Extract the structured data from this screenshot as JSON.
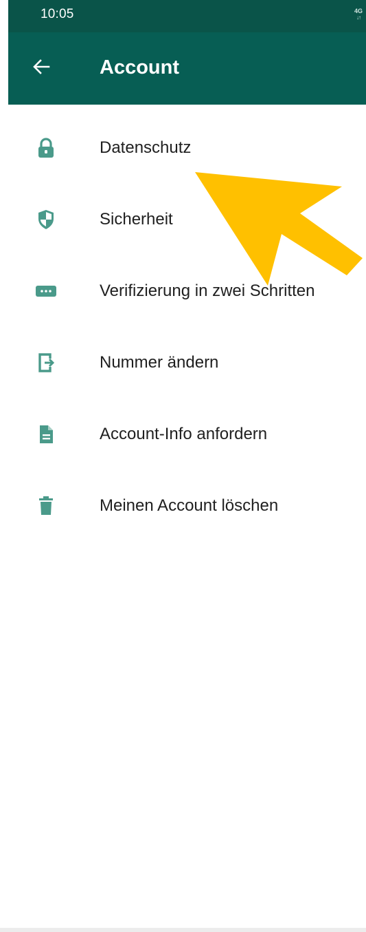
{
  "status_bar": {
    "time": "10:05",
    "network": "4G",
    "network_arrows": "↓↑"
  },
  "header": {
    "title": "Account",
    "back_icon": "arrow-left-icon"
  },
  "items": [
    {
      "label": "Datenschutz",
      "icon": "lock-icon"
    },
    {
      "label": "Sicherheit",
      "icon": "shield-icon"
    },
    {
      "label": "Verifizierung in zwei Schritten",
      "icon": "dots-icon"
    },
    {
      "label": "Nummer ändern",
      "icon": "phone-change-icon"
    },
    {
      "label": "Account-Info anfordern",
      "icon": "document-icon"
    },
    {
      "label": "Meinen Account löschen",
      "icon": "trash-icon"
    }
  ],
  "colors": {
    "header": "#075e54",
    "status_bar": "#0a5449",
    "icon": "#4a9a8a",
    "annotation_arrow": "#ffc000"
  }
}
